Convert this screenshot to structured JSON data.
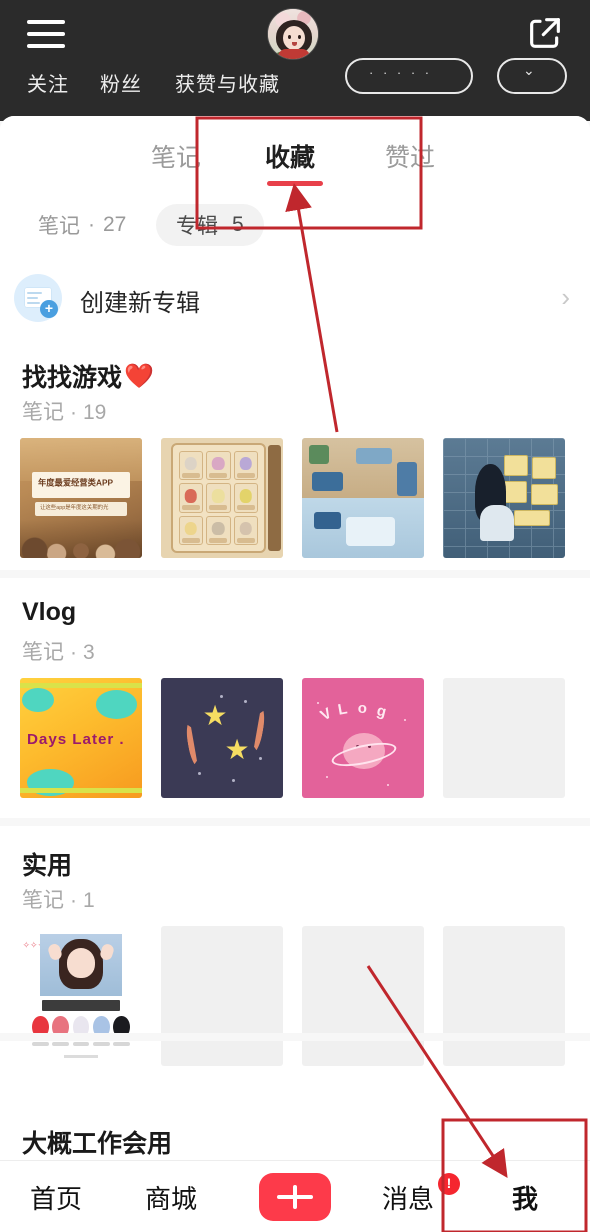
{
  "header": {
    "menu_icon": "hamburger-menu-icon",
    "avatar_alt": "user-avatar",
    "share_icon": "share-external-icon",
    "stats": [
      {
        "label": "关注"
      },
      {
        "label": "粉丝"
      },
      {
        "label": "获赞与收藏"
      }
    ],
    "pill_wide_text": "· · · · ·",
    "pill_small_icon": "chevron-down-icon"
  },
  "tabs": [
    {
      "label": "笔记",
      "active": false
    },
    {
      "label": "收藏",
      "active": true
    },
    {
      "label": "赞过",
      "active": false
    }
  ],
  "chips": [
    {
      "label": "笔记",
      "separator": "·",
      "count": "27",
      "active": false
    },
    {
      "label": "专辑",
      "separator": "",
      "count": "5",
      "active": true
    }
  ],
  "create_album": {
    "label": "创建新专辑",
    "icon": "album-add-icon",
    "chevron": "›"
  },
  "albums": [
    {
      "title": "找找游戏",
      "emoji": "❤️",
      "meta_label": "笔记",
      "meta_dot": "·",
      "meta_count": "19",
      "thumbs": [
        {
          "name": "thumb-game-management-app",
          "art": "tA",
          "caption": "年度最爱经营类APP",
          "subcaption": "让这些app是年度这关期的光"
        },
        {
          "name": "thumb-character-grid",
          "art": "tB",
          "caption": ""
        },
        {
          "name": "thumb-pixel-room",
          "art": "tC",
          "caption": ""
        },
        {
          "name": "thumb-girl-wall-notes",
          "art": "tD",
          "caption": ""
        }
      ]
    },
    {
      "title": "Vlog",
      "emoji": "",
      "meta_label": "笔记",
      "meta_dot": "·",
      "meta_count": "3",
      "thumbs": [
        {
          "name": "thumb-days-later",
          "art": "tE",
          "caption": "Days Later ."
        },
        {
          "name": "thumb-stars-night",
          "art": "tF",
          "caption": ""
        },
        {
          "name": "thumb-vlog-planet",
          "art": "tG",
          "caption": "VLOG"
        },
        {
          "name": "thumb-empty-slot",
          "art": "empty",
          "caption": ""
        }
      ]
    },
    {
      "title": "实用",
      "emoji": "",
      "meta_label": "笔记",
      "meta_dot": "·",
      "meta_count": "1",
      "thumbs": [
        {
          "name": "thumb-color-palette",
          "art": "tH",
          "caption": ""
        },
        {
          "name": "thumb-empty-slot",
          "art": "empty",
          "caption": ""
        },
        {
          "name": "thumb-empty-slot",
          "art": "empty",
          "caption": ""
        },
        {
          "name": "thumb-empty-slot",
          "art": "empty",
          "caption": ""
        }
      ]
    }
  ],
  "peek_album": {
    "title": "大概工作会用"
  },
  "bottom_nav": {
    "items": [
      {
        "label": "首页"
      },
      {
        "label": "商城"
      },
      {
        "label": "消息",
        "badge": "!"
      },
      {
        "label": "我",
        "active": true
      }
    ],
    "plus_label": "+"
  },
  "annotations": {
    "color": "#c0272d",
    "box_top": "collections-tab-highlight",
    "box_bottom": "me-tab-highlight",
    "arrow_top": "arrow-to-collections-tab",
    "arrow_bottom": "arrow-to-me-tab"
  }
}
